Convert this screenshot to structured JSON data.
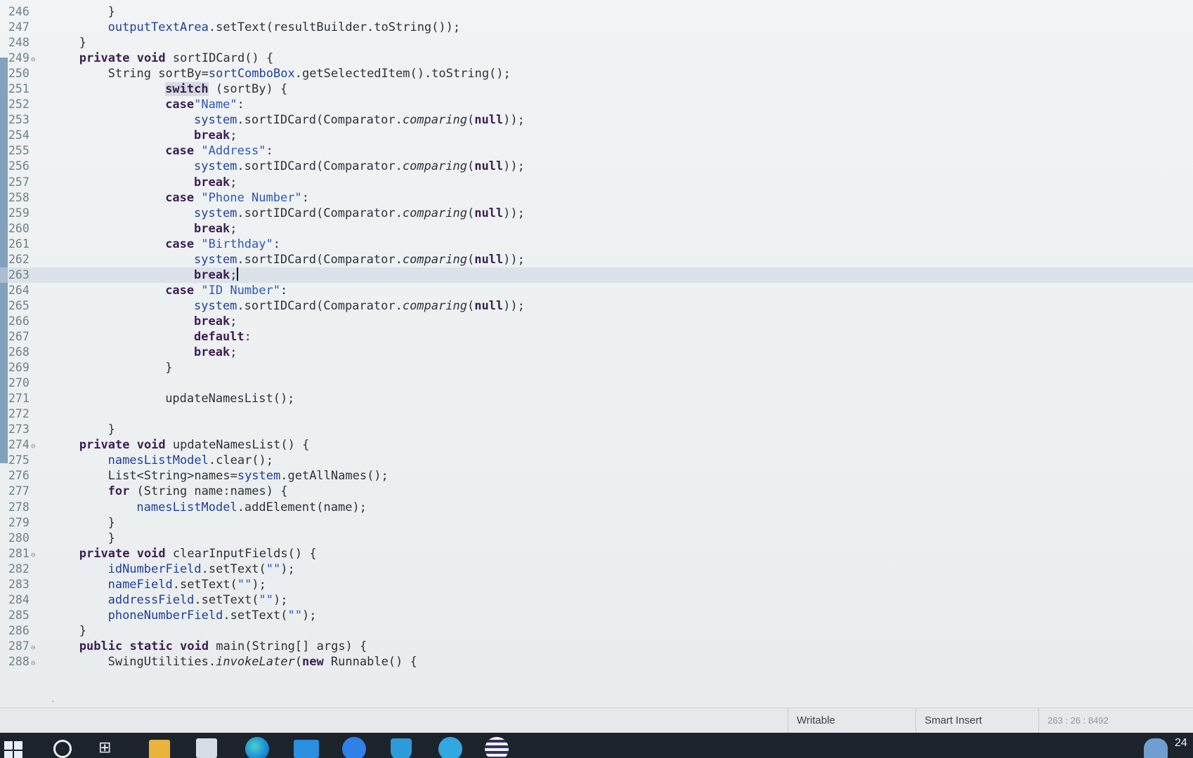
{
  "editor": {
    "lines": [
      {
        "n": "246",
        "fold": false,
        "indent": 8,
        "tokens": [
          [
            "plain",
            "}"
          ]
        ]
      },
      {
        "n": "247",
        "fold": false,
        "indent": 8,
        "tokens": [
          [
            "fld",
            "outputTextArea"
          ],
          [
            "plain",
            ".setText(resultBuilder.toString());"
          ]
        ]
      },
      {
        "n": "248",
        "fold": false,
        "indent": 4,
        "tokens": [
          [
            "plain",
            "}"
          ]
        ]
      },
      {
        "n": "249",
        "fold": true,
        "indent": 4,
        "tokens": [
          [
            "kw",
            "private"
          ],
          [
            "plain",
            " "
          ],
          [
            "kw",
            "void"
          ],
          [
            "plain",
            " sortIDCard() {"
          ]
        ]
      },
      {
        "n": "250",
        "fold": false,
        "indent": 8,
        "tokens": [
          [
            "plain",
            "String sortBy="
          ],
          [
            "fld",
            "sortComboBox"
          ],
          [
            "plain",
            ".getSelectedItem().toString();"
          ]
        ]
      },
      {
        "n": "251",
        "fold": false,
        "indent": 16,
        "tokens": [
          [
            "kw-hl",
            "switch"
          ],
          [
            "plain",
            " (sortBy) {"
          ]
        ]
      },
      {
        "n": "252",
        "fold": false,
        "indent": 16,
        "tokens": [
          [
            "kw",
            "case"
          ],
          [
            "str",
            "\"Name\""
          ],
          [
            "plain",
            ":"
          ]
        ]
      },
      {
        "n": "253",
        "fold": false,
        "indent": 20,
        "tokens": [
          [
            "fld",
            "system"
          ],
          [
            "plain",
            ".sortIDCard(Comparator."
          ],
          [
            "it",
            "comparing"
          ],
          [
            "plain",
            "("
          ],
          [
            "kw",
            "null"
          ],
          [
            "plain",
            "));"
          ]
        ]
      },
      {
        "n": "254",
        "fold": false,
        "indent": 20,
        "tokens": [
          [
            "kw",
            "break"
          ],
          [
            "plain",
            ";"
          ]
        ]
      },
      {
        "n": "255",
        "fold": false,
        "indent": 16,
        "tokens": [
          [
            "kw",
            "case"
          ],
          [
            "plain",
            " "
          ],
          [
            "str",
            "\"Address\""
          ],
          [
            "plain",
            ":"
          ]
        ]
      },
      {
        "n": "256",
        "fold": false,
        "indent": 20,
        "tokens": [
          [
            "fld",
            "system"
          ],
          [
            "plain",
            ".sortIDCard(Comparator."
          ],
          [
            "it",
            "comparing"
          ],
          [
            "plain",
            "("
          ],
          [
            "kw",
            "null"
          ],
          [
            "plain",
            "));"
          ]
        ]
      },
      {
        "n": "257",
        "fold": false,
        "indent": 20,
        "tokens": [
          [
            "kw",
            "break"
          ],
          [
            "plain",
            ";"
          ]
        ]
      },
      {
        "n": "258",
        "fold": false,
        "indent": 16,
        "tokens": [
          [
            "kw",
            "case"
          ],
          [
            "plain",
            " "
          ],
          [
            "str",
            "\"Phone Number\""
          ],
          [
            "plain",
            ":"
          ]
        ]
      },
      {
        "n": "259",
        "fold": false,
        "indent": 20,
        "tokens": [
          [
            "fld",
            "system"
          ],
          [
            "plain",
            ".sortIDCard(Comparator."
          ],
          [
            "it",
            "comparing"
          ],
          [
            "plain",
            "("
          ],
          [
            "kw",
            "null"
          ],
          [
            "plain",
            "));"
          ]
        ]
      },
      {
        "n": "260",
        "fold": false,
        "indent": 20,
        "tokens": [
          [
            "kw",
            "break"
          ],
          [
            "plain",
            ";"
          ]
        ]
      },
      {
        "n": "261",
        "fold": false,
        "indent": 16,
        "tokens": [
          [
            "kw",
            "case"
          ],
          [
            "plain",
            " "
          ],
          [
            "str",
            "\"Birthday\""
          ],
          [
            "plain",
            ":"
          ]
        ]
      },
      {
        "n": "262",
        "fold": false,
        "indent": 20,
        "tokens": [
          [
            "fld",
            "system"
          ],
          [
            "plain",
            ".sortIDCard(Comparator."
          ],
          [
            "it",
            "comparing"
          ],
          [
            "plain",
            "("
          ],
          [
            "kw",
            "null"
          ],
          [
            "plain",
            "));"
          ]
        ]
      },
      {
        "n": "263",
        "fold": false,
        "indent": 20,
        "current": true,
        "tokens": [
          [
            "kw",
            "break"
          ],
          [
            "plain",
            ";"
          ],
          [
            "caret",
            ""
          ]
        ]
      },
      {
        "n": "264",
        "fold": false,
        "indent": 16,
        "tokens": [
          [
            "kw",
            "case"
          ],
          [
            "plain",
            " "
          ],
          [
            "str",
            "\"ID Number\""
          ],
          [
            "plain",
            ":"
          ]
        ]
      },
      {
        "n": "265",
        "fold": false,
        "indent": 20,
        "tokens": [
          [
            "fld",
            "system"
          ],
          [
            "plain",
            ".sortIDCard(Comparator."
          ],
          [
            "it",
            "comparing"
          ],
          [
            "plain",
            "("
          ],
          [
            "kw",
            "null"
          ],
          [
            "plain",
            "));"
          ]
        ]
      },
      {
        "n": "266",
        "fold": false,
        "indent": 20,
        "tokens": [
          [
            "kw",
            "break"
          ],
          [
            "plain",
            ";"
          ]
        ]
      },
      {
        "n": "267",
        "fold": false,
        "indent": 20,
        "tokens": [
          [
            "kw",
            "default"
          ],
          [
            "plain",
            ":"
          ]
        ]
      },
      {
        "n": "268",
        "fold": false,
        "indent": 20,
        "tokens": [
          [
            "kw",
            "break"
          ],
          [
            "plain",
            ";"
          ]
        ]
      },
      {
        "n": "269",
        "fold": false,
        "indent": 16,
        "tokens": [
          [
            "plain",
            "}"
          ]
        ]
      },
      {
        "n": "270",
        "fold": false,
        "indent": 0,
        "tokens": []
      },
      {
        "n": "271",
        "fold": false,
        "indent": 16,
        "tokens": [
          [
            "plain",
            "updateNamesList();"
          ]
        ]
      },
      {
        "n": "272",
        "fold": false,
        "indent": 0,
        "tokens": []
      },
      {
        "n": "273",
        "fold": false,
        "indent": 8,
        "tokens": [
          [
            "plain",
            "}"
          ]
        ]
      },
      {
        "n": "274",
        "fold": true,
        "indent": 4,
        "tokens": [
          [
            "kw",
            "private"
          ],
          [
            "plain",
            " "
          ],
          [
            "kw",
            "void"
          ],
          [
            "plain",
            " updateNamesList() {"
          ]
        ]
      },
      {
        "n": "275",
        "fold": false,
        "indent": 8,
        "tokens": [
          [
            "fld",
            "namesListModel"
          ],
          [
            "plain",
            ".clear();"
          ]
        ]
      },
      {
        "n": "276",
        "fold": false,
        "indent": 8,
        "tokens": [
          [
            "plain",
            "List<String>names="
          ],
          [
            "fld",
            "system"
          ],
          [
            "plain",
            ".getAllNames();"
          ]
        ]
      },
      {
        "n": "277",
        "fold": false,
        "indent": 8,
        "tokens": [
          [
            "kw",
            "for"
          ],
          [
            "plain",
            " (String name:names) {"
          ]
        ]
      },
      {
        "n": "278",
        "fold": false,
        "indent": 12,
        "tokens": [
          [
            "fld",
            "namesListModel"
          ],
          [
            "plain",
            ".addElement(name);"
          ]
        ]
      },
      {
        "n": "279",
        "fold": false,
        "indent": 8,
        "tokens": [
          [
            "plain",
            "}"
          ]
        ]
      },
      {
        "n": "280",
        "fold": false,
        "indent": 8,
        "tokens": [
          [
            "plain",
            "}"
          ]
        ]
      },
      {
        "n": "281",
        "fold": true,
        "indent": 4,
        "tokens": [
          [
            "kw",
            "private"
          ],
          [
            "plain",
            " "
          ],
          [
            "kw",
            "void"
          ],
          [
            "plain",
            " clearInputFields() {"
          ]
        ]
      },
      {
        "n": "282",
        "fold": false,
        "indent": 8,
        "tokens": [
          [
            "fld",
            "idNumberField"
          ],
          [
            "plain",
            ".setText("
          ],
          [
            "str",
            "\"\""
          ],
          [
            "plain",
            ");"
          ]
        ]
      },
      {
        "n": "283",
        "fold": false,
        "indent": 8,
        "tokens": [
          [
            "fld",
            "nameField"
          ],
          [
            "plain",
            ".setText("
          ],
          [
            "str",
            "\"\""
          ],
          [
            "plain",
            ");"
          ]
        ]
      },
      {
        "n": "284",
        "fold": false,
        "indent": 8,
        "tokens": [
          [
            "fld",
            "addressField"
          ],
          [
            "plain",
            ".setText("
          ],
          [
            "str",
            "\"\""
          ],
          [
            "plain",
            ");"
          ]
        ]
      },
      {
        "n": "285",
        "fold": false,
        "indent": 8,
        "tokens": [
          [
            "fld",
            "phoneNumberField"
          ],
          [
            "plain",
            ".setText("
          ],
          [
            "str",
            "\"\""
          ],
          [
            "plain",
            ");"
          ]
        ]
      },
      {
        "n": "286",
        "fold": false,
        "indent": 4,
        "tokens": [
          [
            "plain",
            "}"
          ]
        ]
      },
      {
        "n": "287",
        "fold": true,
        "indent": 4,
        "tokens": [
          [
            "kw",
            "public"
          ],
          [
            "plain",
            " "
          ],
          [
            "kw",
            "static"
          ],
          [
            "plain",
            " "
          ],
          [
            "kw",
            "void"
          ],
          [
            "plain",
            " main(String[] args) {"
          ]
        ]
      },
      {
        "n": "288",
        "fold": true,
        "indent": 8,
        "tokens": [
          [
            "plain",
            "SwingUtilities."
          ],
          [
            "it",
            "invokeLater"
          ],
          [
            "plain",
            "("
          ],
          [
            "kw",
            "new"
          ],
          [
            "plain",
            " Runnable() {"
          ]
        ]
      }
    ],
    "fold_marker": "⊖",
    "scroll_left_glyph": "‹"
  },
  "status_bar": {
    "writable": "Writable",
    "insert_mode": "Smart Insert",
    "position": "263 : 26 : 8492"
  },
  "taskbar": {
    "icons": [
      "windows-start-icon",
      "search-icon",
      "task-view-icon",
      "file-explorer-icon",
      "store-icon",
      "edge-browser-icon",
      "mail-icon",
      "zoom-icon",
      "shield-app-icon",
      "telegram-icon",
      "eclipse-icon",
      "weather-icon"
    ],
    "task_view_glyph": "⊞",
    "tray_time": "24"
  },
  "colors": {
    "keyword": "#3b1f54",
    "string": "#2d57b8",
    "field": "#1f3f9a",
    "line_number": "#6f7f8c",
    "change_bar": "#6f93b3",
    "taskbar": "#1d232a"
  }
}
